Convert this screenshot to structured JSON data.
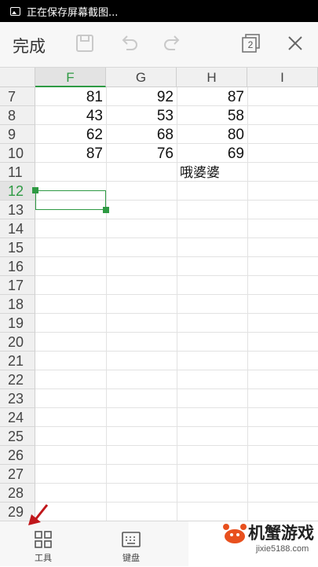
{
  "status_bar": {
    "text": "正在保存屏幕截图..."
  },
  "toolbar": {
    "done_label": "完成",
    "window_count": "2"
  },
  "columns": [
    "F",
    "G",
    "H",
    "I"
  ],
  "rows": [
    "7",
    "8",
    "9",
    "10",
    "11",
    "12",
    "13",
    "14",
    "15",
    "16",
    "17",
    "18",
    "19",
    "20",
    "21",
    "22",
    "23",
    "24",
    "25",
    "26",
    "27",
    "28",
    "29"
  ],
  "cells": {
    "r7": [
      "81",
      "92",
      "87"
    ],
    "r8": [
      "43",
      "53",
      "58"
    ],
    "r9": [
      "62",
      "68",
      "80"
    ],
    "r10": [
      "87",
      "76",
      "69"
    ],
    "r11_h": "哦婆婆"
  },
  "selected_cell": {
    "column": "F",
    "row": "12"
  },
  "bottom_bar": {
    "tools_label": "工具",
    "keyboard_label": "键盘"
  },
  "watermark": {
    "brand": "机蟹游戏",
    "url": "jixie5188.com"
  },
  "colors": {
    "accent": "#2e9a43",
    "arrow": "#c0171b"
  }
}
